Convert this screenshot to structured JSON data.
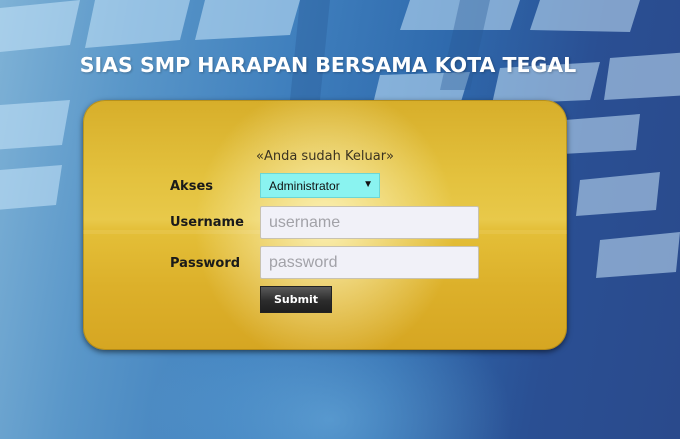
{
  "page": {
    "title": "SIAS SMP HARAPAN BERSAMA KOTA TEGAL"
  },
  "login": {
    "status_message": "«Anda sudah Keluar»",
    "akses_label": "Akses",
    "akses_selected": "Administrator",
    "username_label": "Username",
    "username_placeholder": "username",
    "username_value": "",
    "password_label": "Password",
    "password_placeholder": "password",
    "password_value": "",
    "submit_label": "Submit"
  },
  "colors": {
    "panel": "#e3c13d",
    "select_bg": "#8af3f0",
    "background": "#3f7fbd",
    "button": "#2c2c2c"
  },
  "icons": {
    "dropdown": "triangle-down-icon"
  }
}
